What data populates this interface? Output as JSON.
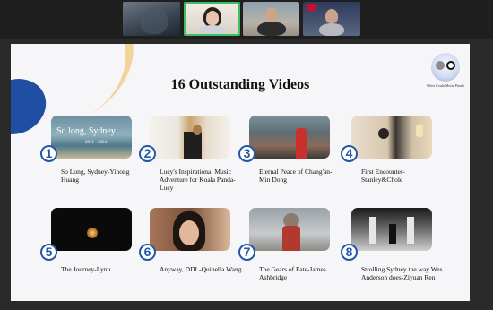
{
  "slide": {
    "title": "16 Outstanding Videos",
    "logo_text": "When Koala Meets Panda"
  },
  "videos": [
    {
      "number": "1",
      "caption": "So Long, Sydney-Yihong Huang",
      "thumb_title": "So long, Sydney",
      "thumb_years": "2011 - 2024"
    },
    {
      "number": "2",
      "caption": "Lucy's Inspirational Music Adventure for Koala Panda-Lucy"
    },
    {
      "number": "3",
      "caption": "Eternal Peace of Chang'an-Min Dong"
    },
    {
      "number": "4",
      "caption": "First Encounter-Stanley&Chole"
    },
    {
      "number": "5",
      "caption": "The Journey-Lynn"
    },
    {
      "number": "6",
      "caption": "Anyway, DDL-Quinella Wang"
    },
    {
      "number": "7",
      "caption": "The Gears of Fate-James Ashbridge"
    },
    {
      "number": "8",
      "caption": "Strolling Sydney the way Wes Anderson does-Ziyuan Ren"
    }
  ]
}
